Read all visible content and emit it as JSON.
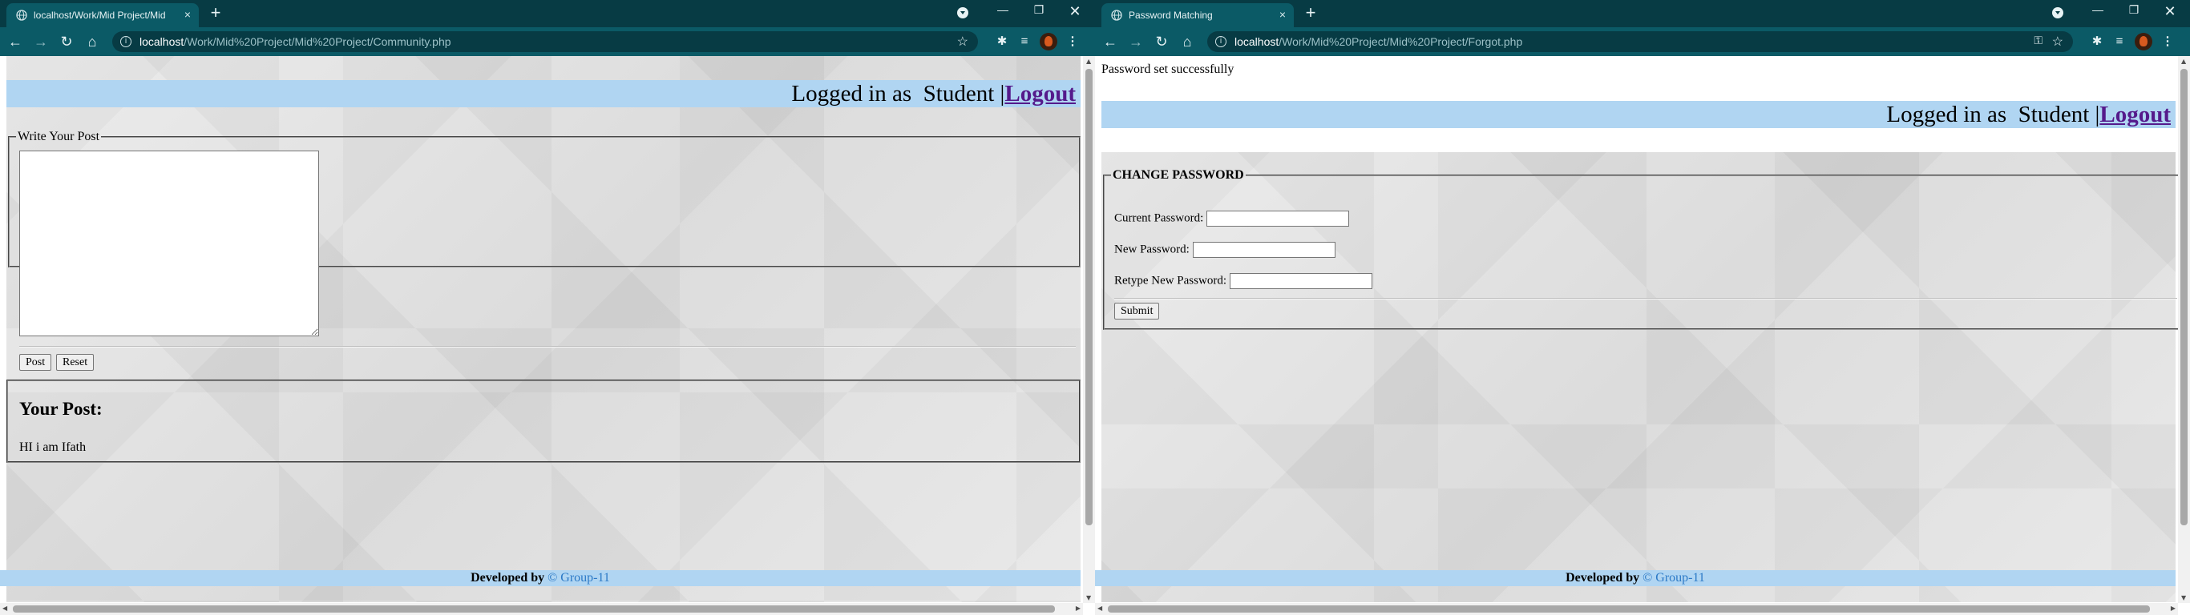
{
  "colors": {
    "chrome_dark": "#073b44",
    "chrome_toolbar": "#0b5a66",
    "header_bar": "#b0d5f2",
    "logout_link": "#551a8b",
    "footer_brand": "#2b79c6"
  },
  "left_window": {
    "tab": {
      "title": "localhost/Work/Mid Project/Mid",
      "close": "×"
    },
    "new_tab": "+",
    "window_controls": {
      "minimize": "—",
      "maximize": "❐",
      "close": "✕"
    },
    "nav": {
      "back": "←",
      "forward": "→",
      "reload": "↻",
      "home": "⌂"
    },
    "address": {
      "host": "localhost",
      "path": "/Work/Mid%20Project/Mid%20Project/Community.php"
    },
    "header": {
      "logged_in_text": "Logged in as  Student |",
      "logout_label": "Logout"
    },
    "write_post": {
      "legend": "Write Your Post",
      "textarea_value": "",
      "post_button": "Post",
      "reset_button": "Reset"
    },
    "your_post": {
      "heading": "Your Post:",
      "text": "HI i am Ifath"
    },
    "footer": {
      "developed_by": "Developed by",
      "brand": "© Group-11"
    }
  },
  "right_window": {
    "tab": {
      "title": "Password Matching",
      "close": "×"
    },
    "new_tab": "+",
    "window_controls": {
      "minimize": "—",
      "maximize": "❐",
      "close": "✕"
    },
    "nav": {
      "back": "←",
      "forward": "→",
      "reload": "↻",
      "home": "⌂"
    },
    "address": {
      "host": "localhost",
      "path": "/Work/Mid%20Project/Mid%20Project/Forgot.php"
    },
    "status_message": "Password set successfully",
    "header": {
      "logged_in_text": "Logged in as  Student |",
      "logout_label": "Logout"
    },
    "change_password": {
      "legend": "CHANGE PASSWORD",
      "current_label": "Current Password:",
      "new_label": "New Password:",
      "retype_label": "Retype New Password:",
      "current_value": "",
      "new_value": "",
      "retype_value": "",
      "submit_button": "Submit"
    },
    "footer": {
      "developed_by": "Developed by",
      "brand": "© Group-11"
    }
  }
}
